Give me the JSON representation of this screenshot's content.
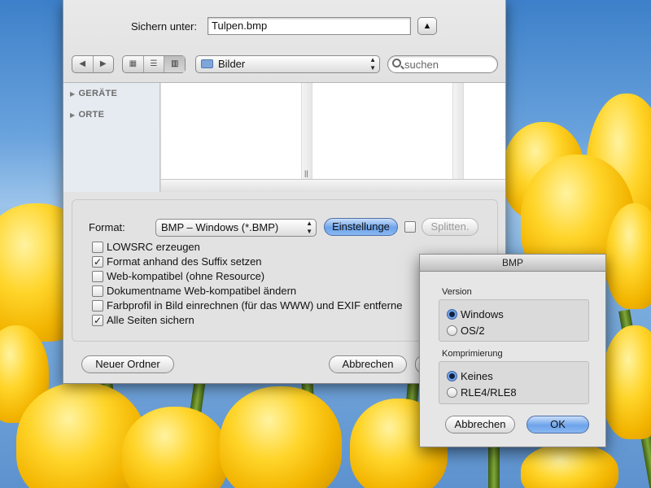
{
  "save_panel": {
    "save_as_label": "Sichern unter:",
    "filename_value": "Tulpen.bmp",
    "expand_icon": "triangle-up-icon",
    "nav_icons": [
      "back-arrow-icon",
      "forward-arrow-icon"
    ],
    "view_icons": [
      "icon-view-icon",
      "list-view-icon",
      "column-view-icon"
    ],
    "location": "Bilder",
    "search_placeholder": "suchen",
    "sidebar": [
      {
        "label": "GERÄTE"
      },
      {
        "label": "ORTE"
      }
    ]
  },
  "options": {
    "format_label": "Format:",
    "format_value": "BMP – Windows (*.BMP)",
    "settings_button": "Einstellunge",
    "split_button": "Splitten.",
    "checkboxes": [
      {
        "label": "LOWSRC erzeugen",
        "checked": false
      },
      {
        "label": "Format anhand des Suffix setzen",
        "checked": true
      },
      {
        "label": "Web-kompatibel (ohne Resource)",
        "checked": false
      },
      {
        "label": "Dokumentname Web-kompatibel ändern",
        "checked": false
      },
      {
        "label": "Farbprofil in Bild einrechnen (für das WWW) und EXIF entferne",
        "checked": false
      },
      {
        "label": "Alle Seiten sichern",
        "checked": true
      }
    ]
  },
  "footer": {
    "new_folder": "Neuer Ordner",
    "cancel": "Abbrechen"
  },
  "bmp_dialog": {
    "title": "BMP",
    "version_label": "Version",
    "version_options": [
      {
        "label": "Windows",
        "selected": true
      },
      {
        "label": "OS/2",
        "selected": false
      }
    ],
    "compression_label": "Komprimierung",
    "compression_options": [
      {
        "label": "Keines",
        "selected": true
      },
      {
        "label": "RLE4/RLE8",
        "selected": false
      }
    ],
    "cancel": "Abbrechen",
    "ok": "OK"
  },
  "colors": {
    "accent_blue": "#6da3ea",
    "tulip_yellow": "#f2b400"
  }
}
